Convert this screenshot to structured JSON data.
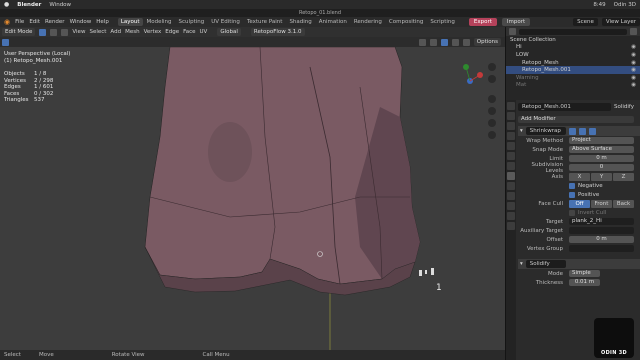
{
  "macbar": {
    "apple": "",
    "app": "Blender",
    "window": "Window",
    "time": "8:49",
    "user": "Odin 3D"
  },
  "title": "Retopo_01.blend",
  "topbar": {
    "menus": [
      "File",
      "Edit",
      "Render",
      "Window",
      "Help"
    ],
    "workspaces": [
      "Layout",
      "Modeling",
      "Sculpting",
      "UV Editing",
      "Texture Paint",
      "Shading",
      "Animation",
      "Rendering",
      "Compositing",
      "Scripting"
    ],
    "active_workspace": "Layout",
    "export": "Export",
    "import": "Import",
    "scene": "Scene",
    "view_layer": "View Layer"
  },
  "viewport_header": {
    "mode": "Edit Mode",
    "menus": [
      "View",
      "Select",
      "Add",
      "Mesh",
      "Vertex",
      "Edge",
      "Face",
      "UV"
    ],
    "transform": "Global",
    "retopoflow": "RetopoFlow 3.1.0",
    "options": "Options"
  },
  "overlay": {
    "view": "User Perspective (Local)",
    "object": "(1) Retopo_Mesh.001",
    "stats": [
      {
        "label": "Objects",
        "value": "1 / 8"
      },
      {
        "label": "Vertices",
        "value": "2 / 298"
      },
      {
        "label": "Edges",
        "value": "1 / 601"
      },
      {
        "label": "Faces",
        "value": "0 / 302"
      },
      {
        "label": "Triangles",
        "value": "537"
      }
    ],
    "marker": "1"
  },
  "statusbar": {
    "select": "Select",
    "move": "Move",
    "rotate": "Rotate View",
    "menu": "Call Menu"
  },
  "outliner": {
    "title": "Scene Collection",
    "rows": [
      {
        "name": "Scene Collection",
        "indent": 0,
        "selected": false
      },
      {
        "name": "Hi",
        "indent": 1,
        "selected": false
      },
      {
        "name": "LOW",
        "indent": 1,
        "selected": false
      },
      {
        "name": "Retopo_Mesh",
        "indent": 2,
        "selected": false
      },
      {
        "name": "Retopo_Mesh.001",
        "indent": 2,
        "selected": true
      },
      {
        "name": "Warning",
        "indent": 1,
        "selected": false
      },
      {
        "name": "Mat",
        "indent": 1,
        "selected": false
      }
    ]
  },
  "properties": {
    "object": "Retopo_Mesh.001",
    "modifier_label": "Solidify",
    "add_modifier": "Add Modifier",
    "shrinkwrap": {
      "name": "Shrinkwrap",
      "wrap_method_label": "Wrap Method",
      "wrap_method": "Project",
      "snap_mode_label": "Snap Mode",
      "snap_mode": "Above Surface",
      "limit_label": "Limit",
      "limit": "0 m",
      "subdiv_label": "Subdivision Levels",
      "subdiv": "0",
      "axis_label": "Axis",
      "axis": [
        "X",
        "Y",
        "Z"
      ],
      "negative": "Negative",
      "positive": "Positive",
      "face_cull_label": "Face Cull",
      "face_cull": [
        "Off",
        "Front",
        "Back"
      ],
      "invert_cull": "Invert Cull",
      "target_label": "Target",
      "target": "plank_2_Hi",
      "aux_label": "Auxiliary Target",
      "offset_label": "Offset",
      "offset": "0 m",
      "vgroup_label": "Vertex Group"
    },
    "solidify": {
      "name": "Solidify",
      "mode_label": "Mode",
      "mode": "Simple",
      "thickness_label": "Thickness",
      "thickness": "0.01 m"
    }
  },
  "logo": "ODIN 3D",
  "colors": {
    "mesh": "#7a5a63",
    "accent": "#4772b3",
    "export": "#b5425b"
  }
}
